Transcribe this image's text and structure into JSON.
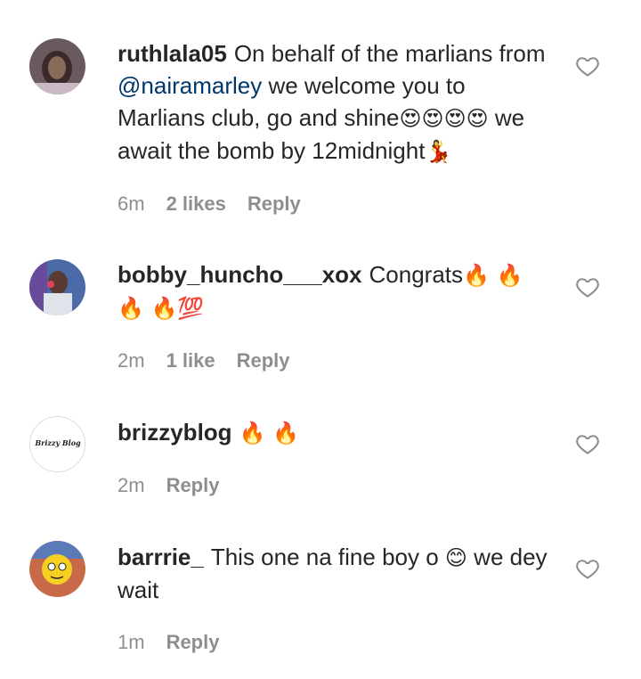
{
  "comments": [
    {
      "username": "ruthlala05",
      "text_parts": [
        "On behalf of the marlians from ",
        "@nairamarley",
        " we welcome you to Marlians club, go and shine",
        "😍😍😍😍",
        " we await the bomb by 12midnight",
        "💃"
      ],
      "time": "6m",
      "likes": "2 likes",
      "reply": "Reply"
    },
    {
      "username": "bobby_huncho___xox",
      "text_parts": [
        "Congrats",
        "🔥 🔥 🔥 🔥💯"
      ],
      "time": "2m",
      "likes": "1 like",
      "reply": "Reply"
    },
    {
      "username": "brizzyblog",
      "text_parts": [
        "🔥 🔥"
      ],
      "time": "2m",
      "reply": "Reply",
      "avatar_text": "Brizzy Blog"
    },
    {
      "username": "barrrie_",
      "text_parts": [
        "This one na fine boy o ",
        "😊",
        " we dey wait"
      ],
      "time": "1m",
      "reply": "Reply"
    }
  ],
  "icons": {
    "like": "heart-outline-icon"
  },
  "colors": {
    "text": "#262626",
    "meta": "#8e8e8e",
    "mention": "#00376b"
  }
}
